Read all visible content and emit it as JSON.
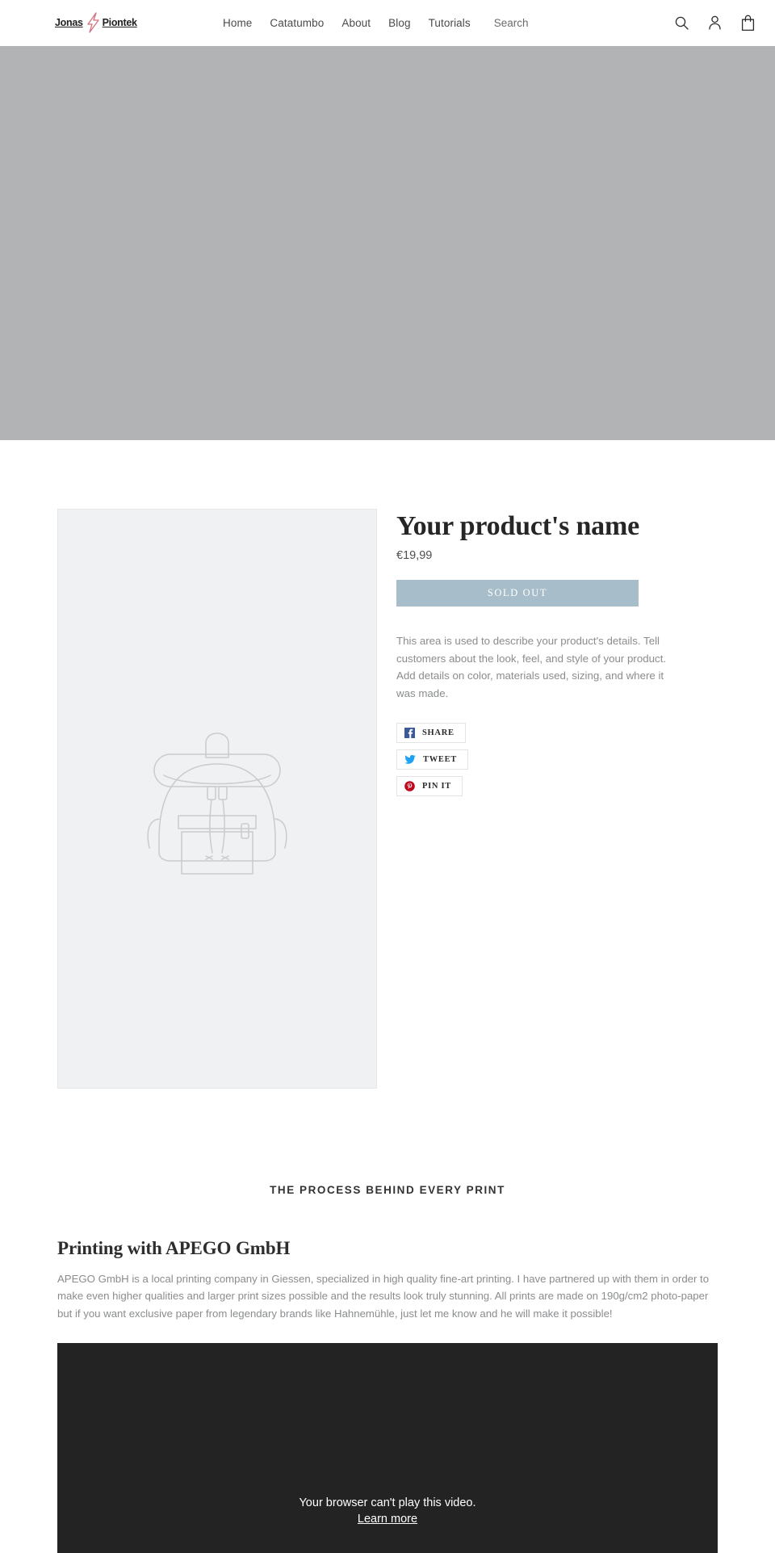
{
  "header": {
    "logo": {
      "first": "Jonas",
      "second": "Piontek",
      "mark": "lightning-bolt-mark",
      "accent_color": "#d4707e"
    },
    "nav": [
      {
        "label": "Home",
        "name": "nav-link-home"
      },
      {
        "label": "Catatumbo",
        "name": "nav-link-catatumbo"
      },
      {
        "label": "About",
        "name": "nav-link-about"
      },
      {
        "label": "Blog",
        "name": "nav-link-blog"
      },
      {
        "label": "Tutorials",
        "name": "nav-link-tutorials"
      }
    ],
    "search": {
      "placeholder": "Search",
      "value": ""
    },
    "icons": [
      {
        "name": "search-icon",
        "label": "Search"
      },
      {
        "name": "account-icon",
        "label": "Log in"
      },
      {
        "name": "cart-icon",
        "label": "Cart"
      }
    ]
  },
  "hero": {
    "background_color": "#b2b3b5"
  },
  "product": {
    "image_placeholder": "backpack-placeholder-illustration",
    "image_background": "#f0f1f2",
    "title": "Your product's name",
    "price": "€19,99",
    "buy_button_label": "Sold out",
    "buy_button_color": "#a7bdca",
    "description": "This area is used to describe your product's details. Tell customers about the look, feel, and style of your product. Add details on color, materials used, sizing, and where it was made.",
    "share_buttons": [
      {
        "label": "Share",
        "network": "facebook",
        "icon": "facebook-icon",
        "color": "#3b5998"
      },
      {
        "label": "Tweet",
        "network": "twitter",
        "icon": "twitter-icon",
        "color": "#1da1f2"
      },
      {
        "label": "Pin it",
        "network": "pinterest",
        "icon": "pinterest-icon",
        "color": "#bd081c"
      }
    ]
  },
  "process": {
    "kicker": "THE PROCESS BEHIND EVERY PRINT",
    "heading": "Printing with APEGO GmbH",
    "paragraph": "APEGO GmbH is a local printing company in Giessen, specialized in high quality fine-art printing. I have partnered up with them in order to make even higher qualities and larger print sizes possible and the results look truly stunning. All prints are made on 190g/cm2 photo-paper but if you want exclusive paper from legendary brands like Hahnemühle, just let me know and he will make it possible!"
  },
  "video": {
    "message": "Your browser can't play this video.",
    "link_label": "Learn more",
    "background_color": "#232323"
  }
}
